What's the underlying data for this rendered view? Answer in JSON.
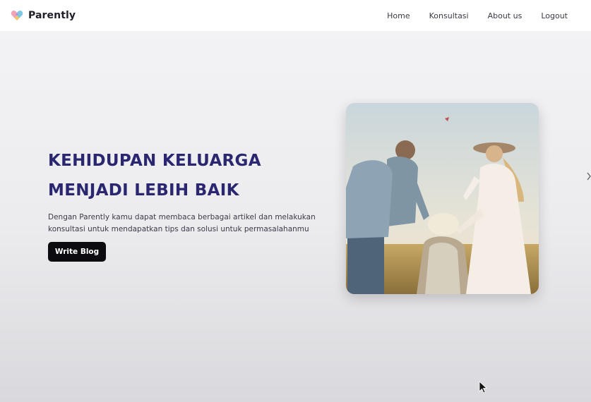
{
  "header": {
    "brand": "Parently",
    "logo_icon": "heart-puzzle-logo",
    "nav": [
      {
        "label": "Home"
      },
      {
        "label": "Konsultasi"
      },
      {
        "label": "About us"
      },
      {
        "label": "Logout"
      }
    ]
  },
  "hero": {
    "title_line1": "KEHIDUPAN KELUARGA",
    "title_line2": "MENJADI LEBIH BAIK",
    "description": "Dengan Parently kamu dapat membaca berbagai artikel dan melakukan konsultasi untuk mendapatkan tips dan solusi untuk permasalahanmu",
    "button_label": "Write Blog",
    "image_icon": "family-photo"
  },
  "colors": {
    "title": "#2a2670",
    "button_bg": "#0c0c10",
    "navbar_bg": "#ffffff"
  }
}
